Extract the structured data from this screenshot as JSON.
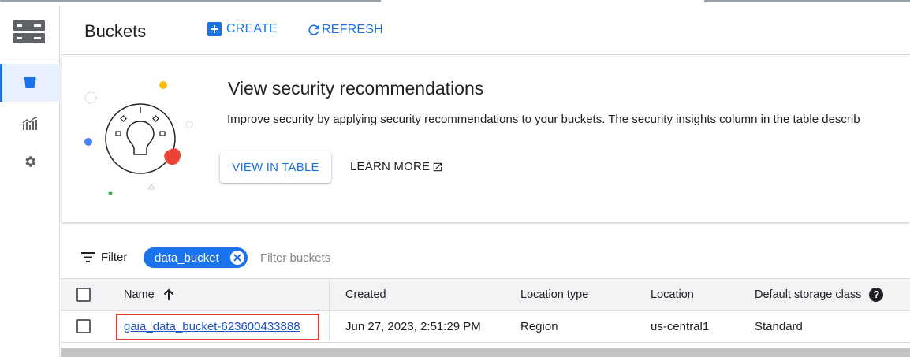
{
  "header": {
    "title": "Buckets",
    "create_label": "CREATE",
    "refresh_label": "REFRESH"
  },
  "leftnav": {
    "product_icon": "storage-icon",
    "items": [
      {
        "name": "buckets",
        "icon": "bucket-icon",
        "active": true
      },
      {
        "name": "monitoring",
        "icon": "chart-icon",
        "active": false
      },
      {
        "name": "settings",
        "icon": "gear-icon",
        "active": false
      }
    ]
  },
  "banner": {
    "title": "View security recommendations",
    "description": "Improve security by applying security recommendations to your buckets. The security insights column in the table describ",
    "view_button": "VIEW IN TABLE",
    "learn_more": "LEARN MORE"
  },
  "filter": {
    "label": "Filter",
    "chip": "data_bucket",
    "placeholder": "Filter buckets"
  },
  "table": {
    "headers": {
      "name": "Name",
      "created": "Created",
      "location_type": "Location type",
      "location": "Location",
      "storage_class": "Default storage class"
    },
    "rows": [
      {
        "name": "gaia_data_bucket-623600433888",
        "created": "Jun 27, 2023, 2:51:29 PM",
        "location_type": "Region",
        "location": "us-central1",
        "storage_class": "Standard"
      }
    ]
  },
  "colors": {
    "accent": "#1a73e8",
    "highlight": "#e53935",
    "nav_active_bg": "#e8f0fe"
  }
}
